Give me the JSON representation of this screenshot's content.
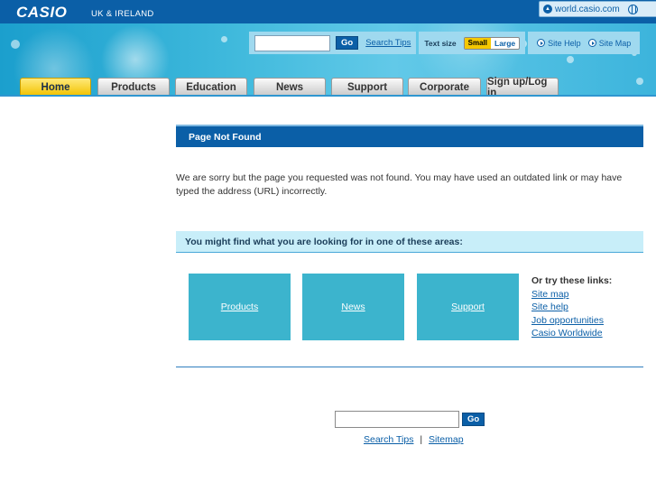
{
  "header": {
    "logo": "CASIO",
    "region": "UK & IRELAND",
    "world_link": "world.casio.com"
  },
  "tools": {
    "search_placeholder": "",
    "go_label": "Go",
    "search_tips": "Search Tips",
    "text_size_label": "Text size",
    "size_small": "Small",
    "size_large": "Large",
    "site_help": "Site Help",
    "site_map": "Site Map"
  },
  "nav": {
    "tabs": [
      {
        "label": "Home",
        "active": true
      },
      {
        "label": "Products",
        "active": false
      },
      {
        "label": "Education",
        "active": false
      },
      {
        "label": "News",
        "active": false
      },
      {
        "label": "Support",
        "active": false
      },
      {
        "label": "Corporate",
        "active": false
      },
      {
        "label": "Sign up/Log in",
        "active": false
      }
    ]
  },
  "main": {
    "title": "Page Not Found",
    "message": "We are sorry but the page you requested was not found. You may have used an outdated link or may have typed the address (URL) incorrectly.",
    "subhead": "You might find what you are looking for in one of these areas:",
    "tiles": [
      "Products",
      "News",
      "Support"
    ],
    "try_label": "Or try these links:",
    "try_links": [
      "Site map",
      "Site help",
      "Job opportunities",
      "Casio Worldwide"
    ]
  },
  "footer": {
    "go_label": "Go",
    "search_tips": "Search Tips",
    "separator": "|",
    "sitemap": "Sitemap"
  },
  "colors": {
    "brand_blue": "#0b5fa7",
    "active_tab": "#f2c200",
    "tile": "#3cb4cd"
  }
}
